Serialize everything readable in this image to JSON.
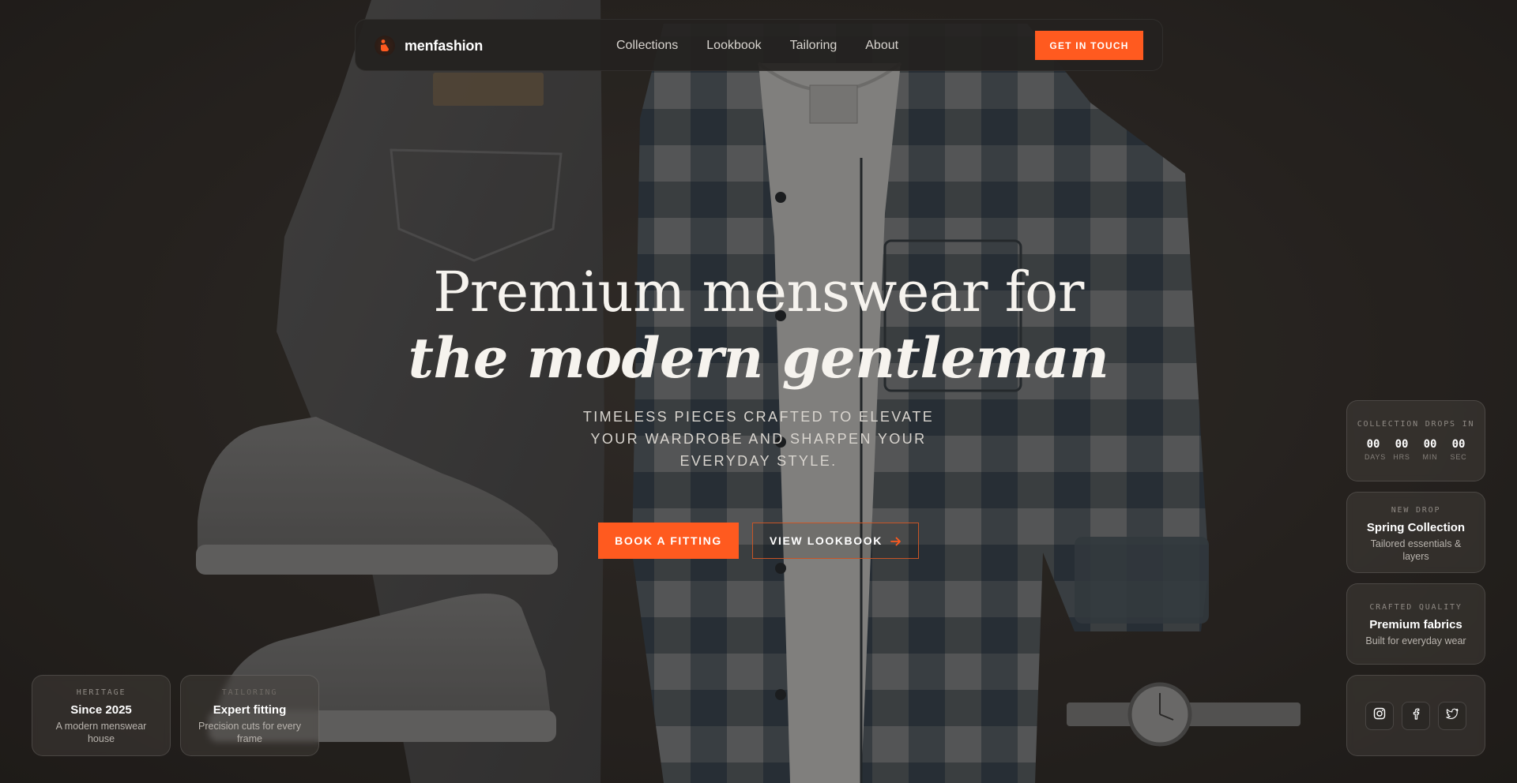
{
  "brand": {
    "name": "menfashion",
    "accent": "#ff5a1f"
  },
  "nav": {
    "items": [
      {
        "label": "Collections"
      },
      {
        "label": "Lookbook"
      },
      {
        "label": "Tailoring"
      },
      {
        "label": "About"
      }
    ],
    "cta_label": "GET IN TOUCH"
  },
  "hero": {
    "headline_line1": "Premium menswear for",
    "headline_line2": "the modern gentleman",
    "subheadline": "TIMELESS PIECES CRAFTED TO ELEVATE YOUR WARDROBE AND SHARPEN YOUR EVERYDAY STYLE.",
    "primary_button": "BOOK A FITTING",
    "secondary_button": "VIEW LOOKBOOK",
    "secondary_icon": "arrow-right-icon"
  },
  "left_cards": [
    {
      "eyebrow": "HERITAGE",
      "title": "Since 2025",
      "desc": "A modern menswear house"
    },
    {
      "eyebrow": "TAILORING",
      "title": "Expert fitting",
      "desc": "Precision cuts for every frame"
    }
  ],
  "countdown": {
    "eyebrow": "COLLECTION DROPS IN",
    "units": [
      {
        "value": "00",
        "label": "DAYS"
      },
      {
        "value": "00",
        "label": "HRS"
      },
      {
        "value": "00",
        "label": "MIN"
      },
      {
        "value": "00",
        "label": "SEC"
      }
    ]
  },
  "new_drop": {
    "eyebrow": "NEW DROP",
    "title": "Spring Collection",
    "desc": "Tailored essentials & layers"
  },
  "quality": {
    "eyebrow": "CRAFTED QUALITY",
    "title": "Premium fabrics",
    "desc": "Built for everyday wear"
  },
  "social": [
    {
      "icon": "instagram-icon"
    },
    {
      "icon": "facebook-icon"
    },
    {
      "icon": "twitter-icon"
    }
  ]
}
